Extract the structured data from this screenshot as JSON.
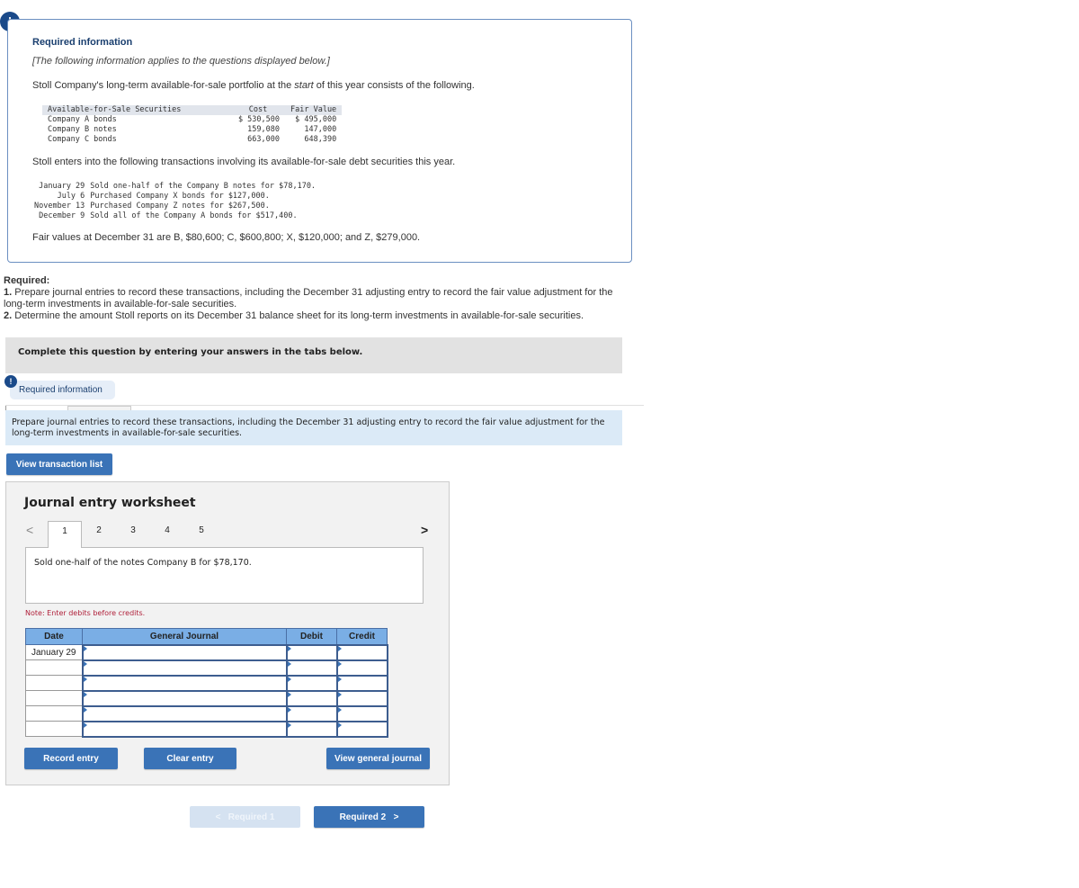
{
  "info": {
    "badge": "!",
    "title": "Required information",
    "note": "[The following information applies to the questions displayed below.]",
    "intro_pre": "Stoll Company's long-term available-for-sale portfolio at the ",
    "intro_em": "start",
    "intro_post": " of this year consists of the following.",
    "securities": {
      "headers": [
        "Available-for-Sale Securities",
        "Cost",
        "Fair Value"
      ],
      "rows": [
        {
          "name": "Company A bonds",
          "cost": "$ 530,500",
          "fair_value": "$ 495,000"
        },
        {
          "name": "Company B notes",
          "cost": "159,080",
          "fair_value": "147,000"
        },
        {
          "name": "Company C bonds",
          "cost": "663,000",
          "fair_value": "648,390"
        }
      ]
    },
    "transactions_intro": "Stoll enters into the following transactions involving its available-for-sale debt securities this year.",
    "transactions": [
      {
        "date": "January 29",
        "text": "Sold one-half of the Company B notes for $78,170."
      },
      {
        "date": "July 6",
        "text": "Purchased Company X bonds for $127,000."
      },
      {
        "date": "November 13",
        "text": "Purchased Company Z notes for $267,500."
      },
      {
        "date": "December 9",
        "text": "Sold all of the Company A bonds for $517,400."
      }
    ],
    "fair_values": "Fair values at December 31 are B, $80,600; C, $600,800; X, $120,000; and Z, $279,000."
  },
  "required": {
    "heading": "Required:",
    "items": [
      {
        "num": "1.",
        "text": " Prepare journal entries to record these transactions, including the December 31 adjusting entry to record the fair value adjustment for the long-term investments in available-for-sale securities."
      },
      {
        "num": "2.",
        "text": " Determine the amount Stoll reports on its December 31 balance sheet for its long-term investments in available-for-sale securities."
      }
    ]
  },
  "complete_bar": "Complete this question by entering your answers in the tabs below.",
  "req_info_tab": {
    "badge": "!",
    "label": "Required information"
  },
  "prepare_text": "Prepare journal entries to record these transactions, including the December 31 adjusting entry to record the fair value adjustment for the long-term investments in available-for-sale securities.",
  "view_transaction_list": "View transaction list",
  "worksheet": {
    "title": "Journal entry worksheet",
    "prev_icon": "<",
    "next_icon": ">",
    "tabs": [
      "1",
      "2",
      "3",
      "4",
      "5"
    ],
    "active_tab": "1",
    "description": "Sold one-half of the notes Company B for $78,170.",
    "note": "Note: Enter debits before credits.",
    "table": {
      "headers": [
        "Date",
        "General Journal",
        "Debit",
        "Credit"
      ],
      "rows": [
        {
          "date": "January 29",
          "account": "",
          "debit": "",
          "credit": ""
        },
        {
          "date": "",
          "account": "",
          "debit": "",
          "credit": ""
        },
        {
          "date": "",
          "account": "",
          "debit": "",
          "credit": ""
        },
        {
          "date": "",
          "account": "",
          "debit": "",
          "credit": ""
        },
        {
          "date": "",
          "account": "",
          "debit": "",
          "credit": ""
        },
        {
          "date": "",
          "account": "",
          "debit": "",
          "credit": ""
        }
      ]
    },
    "record_entry": "Record entry",
    "clear_entry": "Clear entry",
    "view_general_journal": "View general journal"
  },
  "nav": {
    "prev_label": "Required 1",
    "prev_icon": "<",
    "next_label": "Required 2",
    "next_icon": ">"
  }
}
